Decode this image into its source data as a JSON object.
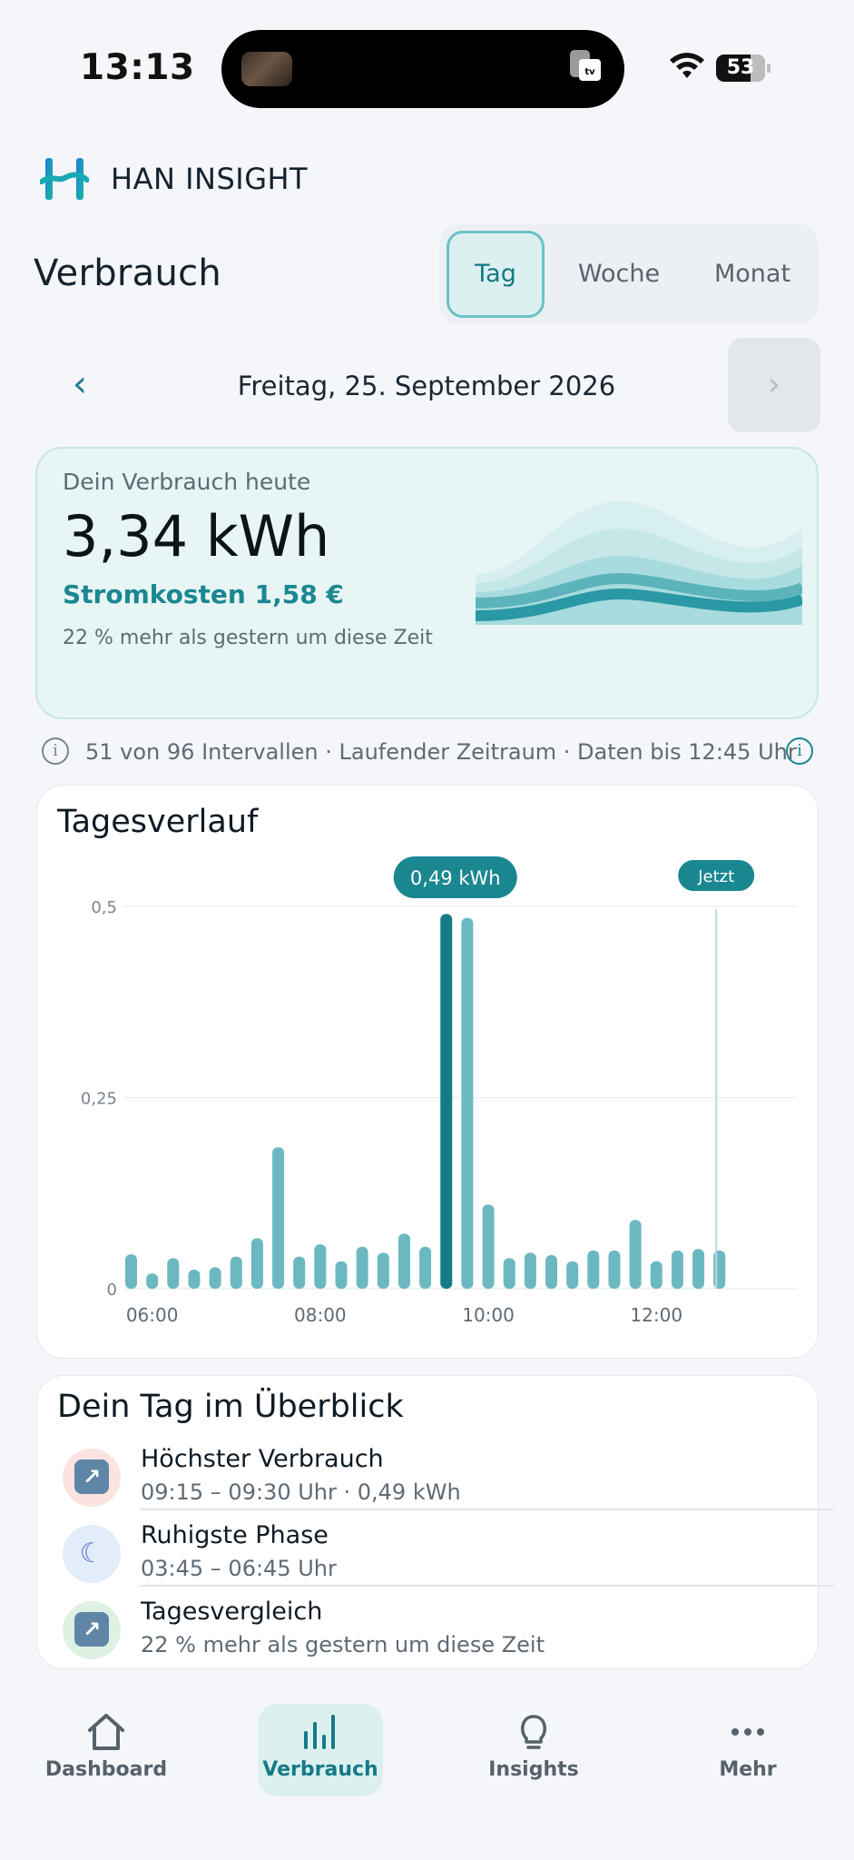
{
  "status_bar": {
    "time": "13:13",
    "battery": "53"
  },
  "app": {
    "brand": "HAN INSIGHT"
  },
  "page": {
    "title": "Verbrauch"
  },
  "segments": [
    {
      "label": "Tag",
      "active": true
    },
    {
      "label": "Woche",
      "active": false
    },
    {
      "label": "Monat",
      "active": false
    }
  ],
  "date_nav": {
    "prev": "‹",
    "date": "Freitag, 25. September 2026",
    "next": "›"
  },
  "summary": {
    "caption": "Dein Verbrauch heute",
    "value": "3,34 kWh",
    "cost": "Stromkosten 1,58 €",
    "comparison": "22 % mehr als gestern um diese Zeit"
  },
  "info": {
    "text": "51 von 96 Intervallen · Laufender Zeitraum · Daten bis 12:45 Uhr"
  },
  "chart_card": {
    "title": "Tagesverlauf",
    "tooltip": "0,49 kWh",
    "now_label": "Jetzt"
  },
  "chart_data": {
    "type": "bar",
    "unit": "kWh",
    "interval": "15 min",
    "x_start": "05:45",
    "x_ticks": [
      "06:00",
      "08:00",
      "10:00",
      "12:00"
    ],
    "y_ticks": [
      "0",
      "0,25",
      "0,5"
    ],
    "ylim": [
      0,
      0.5
    ],
    "highlighted_index": 15,
    "now_time": "12:45",
    "values": [
      0.045,
      0.02,
      0.04,
      0.025,
      0.028,
      0.042,
      0.066,
      0.185,
      0.042,
      0.058,
      0.036,
      0.055,
      0.047,
      0.072,
      0.055,
      0.49,
      0.485,
      0.11,
      0.04,
      0.047,
      0.044,
      0.036,
      0.05,
      0.05,
      0.09,
      0.036,
      0.05,
      0.052,
      0.05
    ]
  },
  "overview": {
    "title": "Dein Tag im Überblick",
    "items": [
      {
        "label": "Höchster Verbrauch",
        "detail": "09:15 – 09:30 Uhr · 0,49 kWh",
        "icon": "arrow-up-right-icon"
      },
      {
        "label": "Ruhigste Phase",
        "detail": "03:45 – 06:45 Uhr",
        "icon": "moon-icon"
      },
      {
        "label": "Tagesvergleich",
        "detail": "22 % mehr als gestern um diese Zeit",
        "icon": "arrow-up-right-icon"
      }
    ]
  },
  "nav": [
    {
      "label": "Dashboard",
      "icon": "home-icon",
      "active": false
    },
    {
      "label": "Verbrauch",
      "icon": "bar-chart-icon",
      "active": true
    },
    {
      "label": "Insights",
      "icon": "lightbulb-icon",
      "active": false
    },
    {
      "label": "Mehr",
      "icon": "more-icon",
      "active": false
    }
  ],
  "colors": {
    "accent": "#1a8791",
    "bar": "#6bb8c1",
    "bar_highlight": "#137c88",
    "card_tint": "#e7f5f4"
  }
}
